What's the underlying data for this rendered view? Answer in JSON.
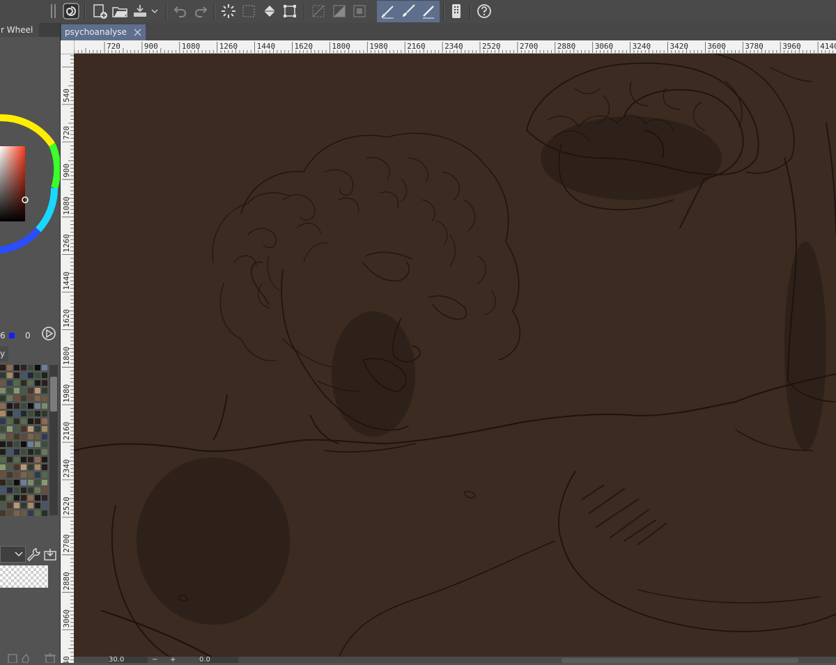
{
  "toolbar": {
    "buttons": [
      {
        "name": "app-logo-icon",
        "icon": "spiral-icon"
      },
      {
        "name": "new-canvas-button",
        "icon": "new-file-icon"
      },
      {
        "name": "open-button",
        "icon": "folder-icon"
      },
      {
        "name": "save-button",
        "icon": "save-tray-icon"
      },
      {
        "name": "save-dropdown-button",
        "icon": "chevron-down-icon"
      },
      {
        "name": "undo-button",
        "icon": "undo-icon"
      },
      {
        "name": "redo-button",
        "icon": "redo-icon"
      },
      {
        "name": "loading-button",
        "icon": "spinner-icon"
      },
      {
        "name": "select-all-button",
        "icon": "dotted-select-icon"
      },
      {
        "name": "fill-button",
        "icon": "fill-bucket-icon"
      },
      {
        "name": "transform-button",
        "icon": "transform-icon"
      },
      {
        "name": "clear-selection-button",
        "icon": "clear-icon"
      },
      {
        "name": "invert-selection-button",
        "icon": "invert-icon"
      },
      {
        "name": "crop-button",
        "icon": "crop-icon"
      },
      {
        "name": "pen-tool-button",
        "icon": "pen-icon"
      },
      {
        "name": "brush-tool-button",
        "icon": "brush-icon"
      },
      {
        "name": "pencil-tool-button",
        "icon": "pencil-icon"
      },
      {
        "name": "device-button",
        "icon": "device-icon"
      },
      {
        "name": "help-button",
        "icon": "help-icon"
      }
    ]
  },
  "left_panel": {
    "colorwheel_tab": "r Wheel",
    "value_a": "6",
    "value_b": "0",
    "layer_label": "y"
  },
  "document": {
    "tab_title": "psychoanalyse",
    "close_icon": "close-icon"
  },
  "rulers": {
    "horizontal": [
      "720",
      "900",
      "1080",
      "1260",
      "1440",
      "1620",
      "1800",
      "1980",
      "2160",
      "2340",
      "2520",
      "2700",
      "2880",
      "3060",
      "3240",
      "3420",
      "3600",
      "3780",
      "3960",
      "4140"
    ],
    "vertical": [
      "540",
      "720",
      "900",
      "1080",
      "1260",
      "1440",
      "1620",
      "1800",
      "1980",
      "2160",
      "2340",
      "2520",
      "2700",
      "2880",
      "3060",
      "40"
    ]
  },
  "status": {
    "zoom": "30.0",
    "rotation": "0.0"
  },
  "colors": {
    "canvas_bg": "#3b2b21",
    "line": "#1c120c",
    "accent": "#5d6f8c"
  }
}
